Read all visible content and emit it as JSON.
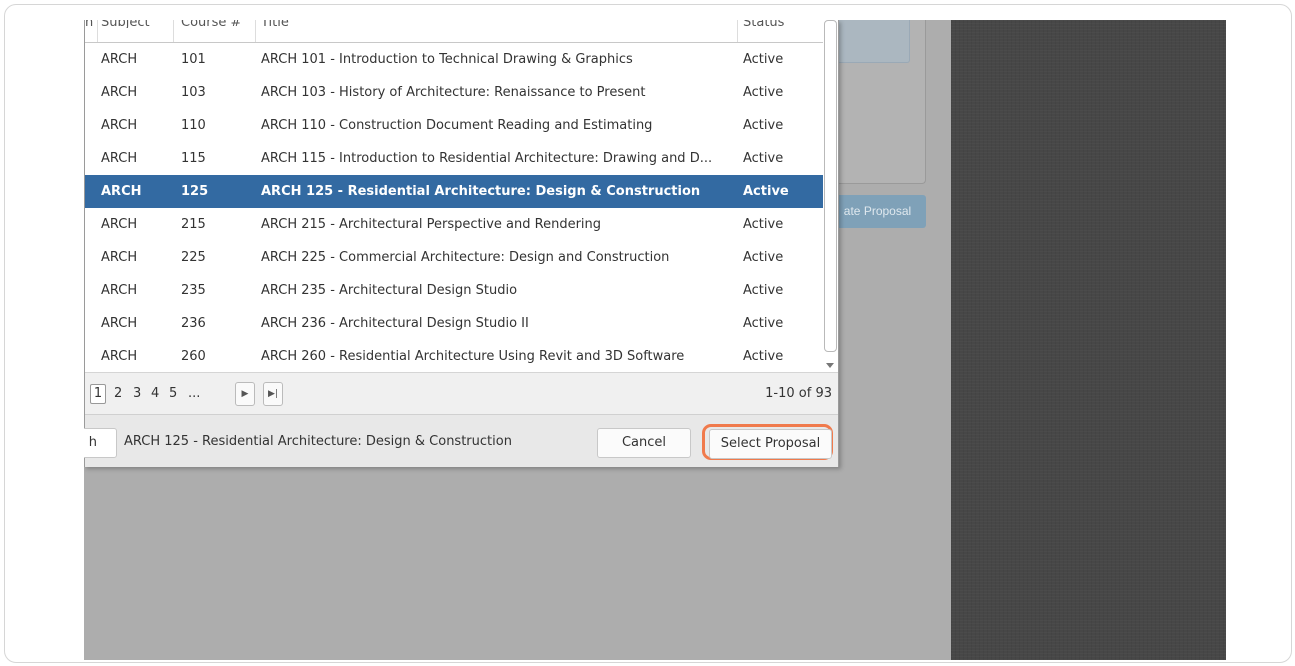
{
  "table": {
    "headers": [
      "n",
      "Subject",
      "Course #",
      "Title",
      "Status"
    ],
    "rows": [
      {
        "subject": "ARCH",
        "course": "101",
        "title": "ARCH 101 - Introduction to Technical Drawing & Graphics",
        "status": "Active"
      },
      {
        "subject": "ARCH",
        "course": "103",
        "title": "ARCH 103 - History of Architecture: Renaissance to Present",
        "status": "Active"
      },
      {
        "subject": "ARCH",
        "course": "110",
        "title": "ARCH 110 - Construction Document Reading and Estimating",
        "status": "Active"
      },
      {
        "subject": "ARCH",
        "course": "115",
        "title": "ARCH 115 - Introduction to Residential Architecture: Drawing and D...",
        "status": "Active"
      },
      {
        "subject": "ARCH",
        "course": "125",
        "title": "ARCH 125 - Residential Architecture: Design & Construction",
        "status": "Active"
      },
      {
        "subject": "ARCH",
        "course": "215",
        "title": "ARCH 215 - Architectural Perspective and Rendering",
        "status": "Active"
      },
      {
        "subject": "ARCH",
        "course": "225",
        "title": "ARCH 225 - Commercial Architecture: Design and Construction",
        "status": "Active"
      },
      {
        "subject": "ARCH",
        "course": "235",
        "title": "ARCH 235 - Architectural Design Studio",
        "status": "Active"
      },
      {
        "subject": "ARCH",
        "course": "236",
        "title": "ARCH 236 - Architectural Design Studio II",
        "status": "Active"
      },
      {
        "subject": "ARCH",
        "course": "260",
        "title": "ARCH 260 - Residential Architecture Using Revit and 3D Software",
        "status": "Active"
      }
    ],
    "selected_index": 4
  },
  "pager": {
    "pages": [
      "1",
      "2",
      "3",
      "4",
      "5",
      "..."
    ],
    "current_page": "1",
    "next_icon": "next-page-icon",
    "last_icon": "last-page-icon",
    "info": "1-10 of 93"
  },
  "footer": {
    "search_label": "h",
    "selected_text": "ARCH 125 - Residential Architecture: Design & Construction",
    "cancel_label": "Cancel",
    "select_label": "Select Proposal"
  },
  "background": {
    "button_label": "ate Proposal"
  },
  "colors": {
    "selected_row": "#336aa2",
    "highlight_outline": "#f07a4c",
    "backdrop": "#adadad",
    "dark_panel": "#474747"
  }
}
